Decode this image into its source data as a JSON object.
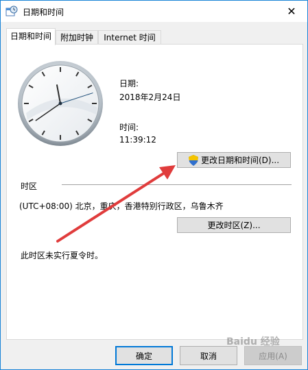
{
  "window": {
    "title": "日期和时间",
    "close_symbol": "✕"
  },
  "tabs": [
    {
      "label": "日期和时间",
      "active": true
    },
    {
      "label": "附加时钟",
      "active": false
    },
    {
      "label": "Internet 时间",
      "active": false
    }
  ],
  "date_section": {
    "date_label": "日期:",
    "date_value": "2018年2月24日",
    "time_label": "时间:",
    "time_value": "11:39:12",
    "change_datetime_button": "更改日期和时间(D)..."
  },
  "clock": {
    "hour": 11,
    "minute": 39,
    "second": 12
  },
  "timezone_section": {
    "heading": "时区",
    "value": "(UTC+08:00) 北京，重庆，香港特别行政区，乌鲁木齐",
    "change_timezone_button": "更改时区(Z)...",
    "dst_note": "此时区未实行夏令时。"
  },
  "footer": {
    "ok": "确定",
    "cancel": "取消",
    "apply": "应用(A)"
  },
  "watermark": "Baidu 经验",
  "colors": {
    "accent": "#0078d7",
    "arrow": "#e03c3c",
    "title_border": "#1883d7"
  },
  "icons": {
    "title": "clock-calendar-icon",
    "shield": "uac-shield-icon",
    "close": "close-icon"
  }
}
